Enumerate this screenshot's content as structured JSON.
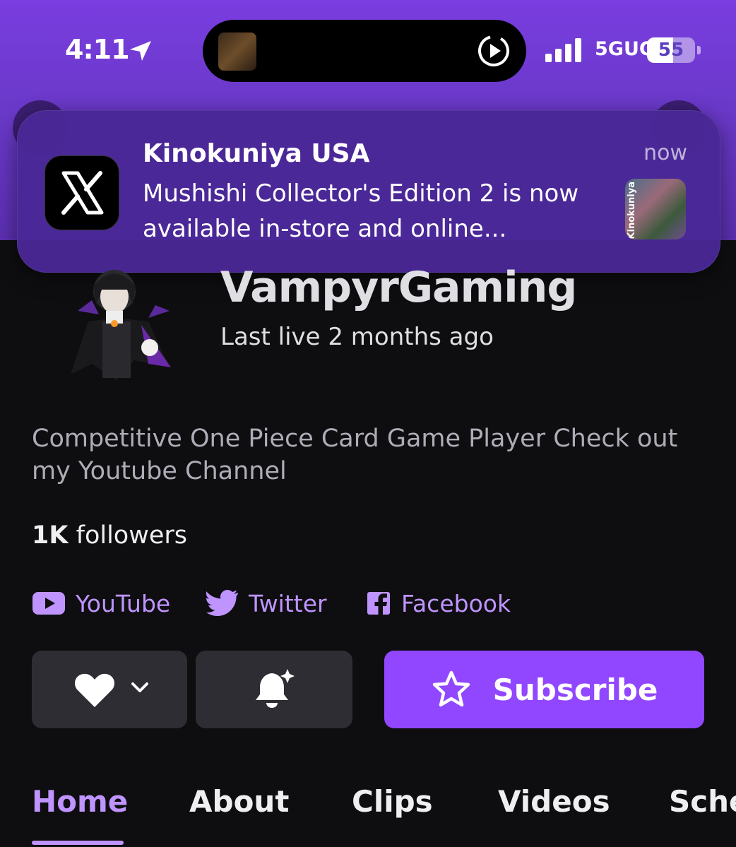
{
  "status_bar": {
    "time": "4:11",
    "network": "5GUC",
    "battery": "55",
    "battery_level": 0.55
  },
  "notification": {
    "app_icon": "x-logo-icon",
    "title": "Kinokuniya USA",
    "time": "now",
    "body": "Mushishi Collector's Edition 2 is now available in-store and online...",
    "thumbnail_text": "Kinokuniya"
  },
  "profile": {
    "channel_name": "VampyrGaming",
    "last_live": "Last live 2 months ago",
    "bio": "Competitive One Piece Card Game Player Check out my Youtube Channel",
    "followers_count": "1K",
    "followers_label": "followers"
  },
  "social_links": [
    {
      "label": "YouTube",
      "icon": "youtube-icon"
    },
    {
      "label": "Twitter",
      "icon": "twitter-icon"
    },
    {
      "label": "Facebook",
      "icon": "facebook-icon"
    }
  ],
  "actions": {
    "follow_icon": "heart-icon",
    "notify_icon": "bell-icon",
    "subscribe_label": "Subscribe"
  },
  "tabs": [
    {
      "label": "Home",
      "active": true
    },
    {
      "label": "About",
      "active": false
    },
    {
      "label": "Clips",
      "active": false
    },
    {
      "label": "Videos",
      "active": false
    },
    {
      "label": "Sche",
      "active": false
    }
  ],
  "colors": {
    "accent": "#9147ff",
    "accent_light": "#bf94ff",
    "header": "#6a39c9",
    "background": "#0e0e10"
  }
}
